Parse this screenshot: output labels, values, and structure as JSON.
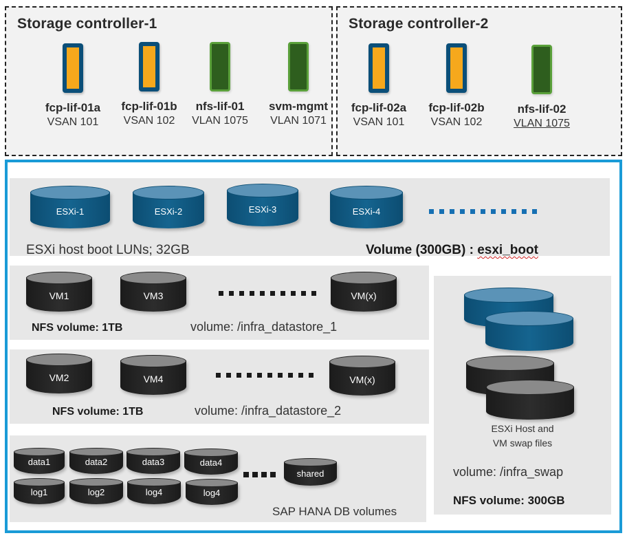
{
  "controllers": [
    {
      "title": "Storage controller-1",
      "lifs": [
        {
          "name": "fcp-lif-01a",
          "network": "VSAN 101",
          "type": "fcp"
        },
        {
          "name": "fcp-lif-01b",
          "network": "VSAN 102",
          "type": "fcp"
        },
        {
          "name": "nfs-lif-01",
          "network": "VLAN 1075",
          "type": "nfs"
        },
        {
          "name": "svm-mgmt",
          "network": "VLAN 1071",
          "type": "nfs"
        }
      ]
    },
    {
      "title": "Storage controller-2",
      "lifs": [
        {
          "name": "fcp-lif-02a",
          "network": "VSAN 101",
          "type": "fcp"
        },
        {
          "name": "fcp-lif-02b",
          "network": "VSAN 102",
          "type": "fcp"
        },
        {
          "name": "nfs-lif-02",
          "network": "VLAN 1075",
          "type": "nfs"
        }
      ]
    }
  ],
  "boot": {
    "luns": [
      "ESXi-1",
      "ESXi-2",
      "ESXi-3",
      "ESXi-4"
    ],
    "caption": "ESXi host boot LUNs; 32GB",
    "volume_prefix": "Volume (300GB) : ",
    "volume_name": "esxi_boot"
  },
  "datastore1": {
    "disks": [
      "VM1",
      "VM3",
      "VM(x)"
    ],
    "size": "NFS volume: 1TB",
    "volume": "volume: /infra_datastore_1"
  },
  "datastore2": {
    "disks": [
      "VM2",
      "VM4",
      "VM(x)"
    ],
    "size": "NFS volume: 1TB",
    "volume": "volume: /infra_datastore_2"
  },
  "hana": {
    "data": [
      "data1",
      "data2",
      "data3",
      "data4"
    ],
    "log": [
      "log1",
      "log2",
      "log4",
      "log4"
    ],
    "shared": "shared",
    "caption": "SAP HANA DB volumes"
  },
  "swap": {
    "caption_line1": "ESXi Host and",
    "caption_line2": "VM swap files",
    "volume": "volume: /infra_swap",
    "size": "NFS volume: 300GB"
  },
  "colors": {
    "frame": "#1a9bd7",
    "fcp_fill": "#f6a81c",
    "fcp_border": "#0b4f79",
    "nfs_fill": "#2e5e1e",
    "nfs_border": "#5aa03a",
    "disk_blue": "#15648f",
    "disk_black": "#222222"
  }
}
